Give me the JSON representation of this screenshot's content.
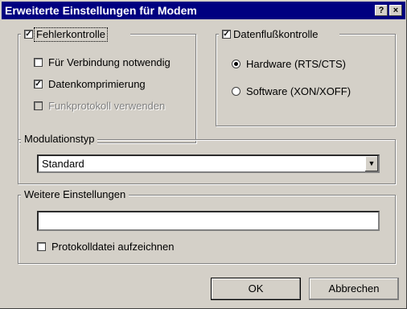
{
  "window": {
    "title": "Erweiterte Einstellungen für Modem",
    "help_button": "?",
    "close_button": "×"
  },
  "fehler": {
    "label": "Fehlerkontrolle",
    "checked": true,
    "options": [
      {
        "label": "Für Verbindung notwendig",
        "checked": false,
        "enabled": true
      },
      {
        "label": "Datenkomprimierung",
        "checked": true,
        "enabled": true
      },
      {
        "label": "Funkprotokoll verwenden",
        "checked": false,
        "enabled": false
      }
    ]
  },
  "fluss": {
    "label": "Datenflußkontrolle",
    "checked": true,
    "options": [
      {
        "label": "Hardware (RTS/CTS)",
        "selected": true
      },
      {
        "label": "Software (XON/XOFF)",
        "selected": false
      }
    ]
  },
  "modulation": {
    "label": "Modulationstyp",
    "value": "Standard"
  },
  "weitere": {
    "label": "Weitere Einstellungen",
    "input_value": "",
    "log_label": "Protokolldatei aufzeichnen",
    "log_checked": false
  },
  "buttons": {
    "ok": "OK",
    "cancel": "Abbrechen"
  }
}
